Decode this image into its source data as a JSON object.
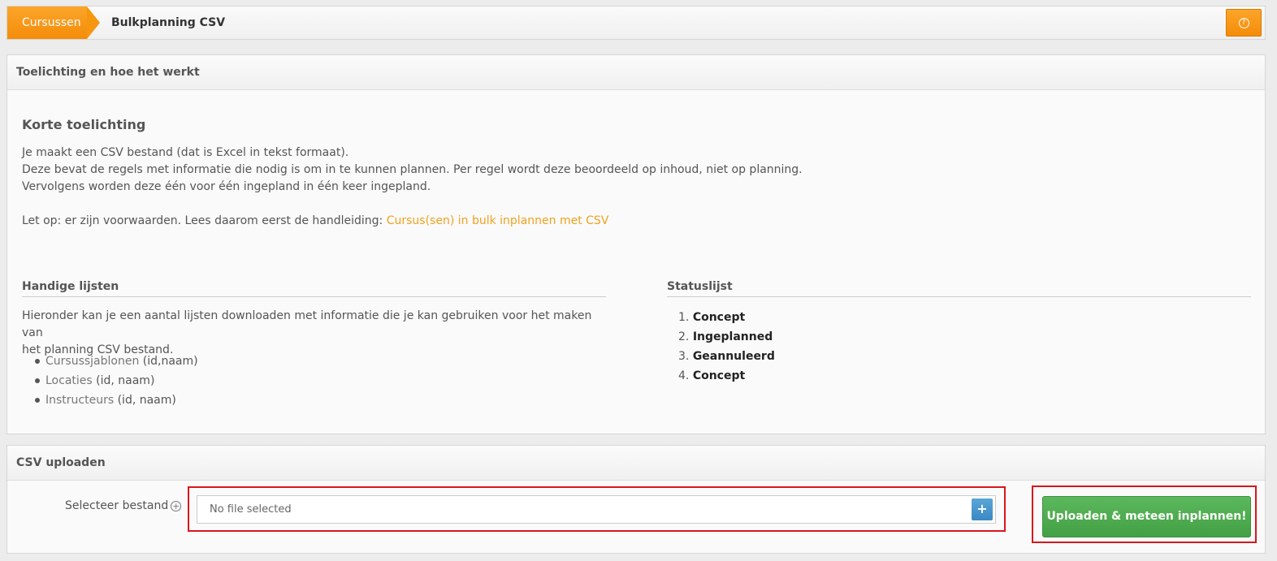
{
  "breadcrumb": {
    "home": "Cursussen",
    "current": "Bulkplanning CSV"
  },
  "help_icon": "question-circle-icon",
  "explain_panel": {
    "title": "Toelichting en hoe het werkt",
    "heading": "Korte toelichting",
    "lines": [
      "Je maakt een CSV bestand (dat is Excel in tekst formaat).",
      "Deze bevat de regels met informatie die nodig is om in te kunnen plannen. Per regel wordt deze beoordeeld op inhoud, niet op planning.",
      "Vervolgens worden deze één voor één ingepland in één keer ingepland."
    ],
    "note_prefix": "Let op: er zijn voorwaarden. Lees daarom eerst de handleiding: ",
    "note_link": "Cursus(sen) in bulk inplannen met CSV",
    "lists": {
      "title": "Handige lijsten",
      "intro_1": "Hieronder kan je een aantal lijsten downloaden met informatie die je kan gebruiken voor het maken van",
      "intro_2": "het planning CSV bestand.",
      "items": [
        {
          "link": "Cursussjablonen",
          "suffix": " (id,naam)"
        },
        {
          "link": "Locaties",
          "suffix": " (id, naam)"
        },
        {
          "link": "Instructeurs",
          "suffix": " (id, naam)"
        }
      ]
    },
    "status": {
      "title": "Statuslijst",
      "items": [
        {
          "num": "1.",
          "label": "Concept"
        },
        {
          "num": "2.",
          "label": "Ingeplanned"
        },
        {
          "num": "3.",
          "label": "Geannuleerd"
        },
        {
          "num": "4.",
          "label": "Concept"
        }
      ]
    }
  },
  "upload_panel": {
    "title": "CSV uploaden",
    "select_label": "Selecteer bestand",
    "file_placeholder": "No file selected",
    "plus": "+",
    "upload_button": "Uploaden & meteen inplannen!",
    "highlight_color": "#d9161b"
  }
}
